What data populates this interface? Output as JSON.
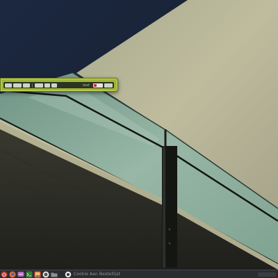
{
  "desktop": {
    "wallpaper": "concrete-building-with-glass-balcony-railing",
    "colors": {
      "sky": "#1a2436",
      "concrete": "#b9b596",
      "glass": "#8fb0a2",
      "toolbar_accent": "#9fb63a",
      "taskbar": "#2a2d30"
    }
  },
  "toolbar": {
    "buttons": [
      "",
      "",
      "",
      "",
      "",
      ""
    ],
    "label": "text",
    "swatch_color": "#d0245d"
  },
  "taskbar": {
    "launchers": [
      {
        "icon": "power-icon",
        "color": "#c0392b"
      },
      {
        "icon": "firefox-icon",
        "color": "#e66b2e"
      },
      {
        "icon": "chat-icon",
        "color": "#b46ac4"
      },
      {
        "icon": "terminal-icon",
        "color": "#4caf50"
      },
      {
        "icon": "photo-icon",
        "color": "#e8574d"
      },
      {
        "icon": "media-icon",
        "color": "#dddddd"
      },
      {
        "icon": "folder-icon",
        "color": "#8a9096"
      }
    ],
    "active_task": {
      "icon": "app-icon",
      "label": "Cookie Aan Bestellijst"
    }
  }
}
